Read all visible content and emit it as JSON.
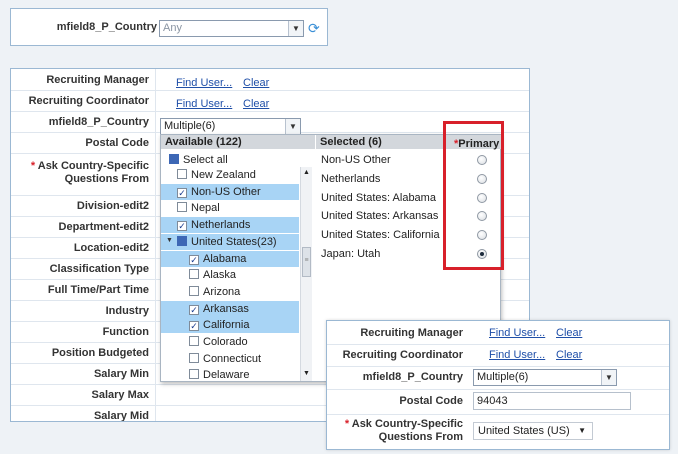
{
  "top_panel": {
    "field_label": "mfield8_P_Country",
    "select_value": "Any"
  },
  "main_form": {
    "rows": [
      {
        "label": "Recruiting Manager",
        "required": false
      },
      {
        "label": "Recruiting Coordinator",
        "required": false
      },
      {
        "label": "mfield8_P_Country",
        "required": false
      },
      {
        "label": "Postal Code",
        "required": false
      },
      {
        "label": "Ask Country-Specific",
        "label2": "Questions From",
        "required": true
      },
      {
        "label": "Division-edit2",
        "required": false
      },
      {
        "label": "Department-edit2",
        "required": false
      },
      {
        "label": "Location-edit2",
        "required": false
      },
      {
        "label": "Classification Type",
        "required": false
      },
      {
        "label": "Full Time/Part Time",
        "required": false
      },
      {
        "label": "Industry",
        "required": false
      },
      {
        "label": "Function",
        "required": false
      },
      {
        "label": "Position Budgeted",
        "required": false
      },
      {
        "label": "Salary Min",
        "required": false
      },
      {
        "label": "Salary Max",
        "required": false
      },
      {
        "label": "Salary Mid",
        "required": false
      }
    ],
    "find_user": "Find User...",
    "clear": "Clear",
    "country_select": "Multiple(6)"
  },
  "dropdown": {
    "available_header": "Available (122)",
    "selected_header": "Selected (6)",
    "primary_header": "Primary",
    "required_star": "*",
    "select_all": "Select all",
    "available_items": [
      {
        "label": "New Zealand",
        "checked": false,
        "selected": false,
        "indent": 0
      },
      {
        "label": "Non-US Other",
        "checked": true,
        "selected": true,
        "indent": 0
      },
      {
        "label": "Nepal",
        "checked": false,
        "selected": false,
        "indent": 0
      },
      {
        "label": "Netherlands",
        "checked": true,
        "selected": true,
        "indent": 0
      },
      {
        "label": "United States(23)",
        "checked": "partial",
        "selected": true,
        "indent": 0
      },
      {
        "label": "Alabama",
        "checked": true,
        "selected": true,
        "indent": 1
      },
      {
        "label": "Alaska",
        "checked": false,
        "selected": false,
        "indent": 1
      },
      {
        "label": "Arizona",
        "checked": false,
        "selected": false,
        "indent": 1
      },
      {
        "label": "Arkansas",
        "checked": true,
        "selected": true,
        "indent": 1
      },
      {
        "label": "California",
        "checked": true,
        "selected": true,
        "indent": 1
      },
      {
        "label": "Colorado",
        "checked": false,
        "selected": false,
        "indent": 1
      },
      {
        "label": "Connecticut",
        "checked": false,
        "selected": false,
        "indent": 1
      },
      {
        "label": "Delaware",
        "checked": false,
        "selected": false,
        "indent": 1
      }
    ],
    "selected_items": [
      {
        "label": "Non-US Other",
        "primary": false
      },
      {
        "label": "Netherlands",
        "primary": false
      },
      {
        "label": "United States: Alabama",
        "primary": false
      },
      {
        "label": "United States: Arkansas",
        "primary": false
      },
      {
        "label": "United States: California",
        "primary": false
      },
      {
        "label": "Japan: Utah",
        "primary": true
      }
    ]
  },
  "inset_form": {
    "recruiting_manager": "Recruiting Manager",
    "recruiting_coordinator": "Recruiting Coordinator",
    "country_label": "mfield8_P_Country",
    "postal_label": "Postal Code",
    "ask_label_1": "Ask Country-Specific",
    "ask_label_2": "Questions From",
    "required_star": "*",
    "find_user": "Find User...",
    "clear": "Clear",
    "country_select": "Multiple(6)",
    "postal_value": "94043",
    "questions_select": "United States (US)"
  },
  "colors": {
    "highlight_box": "#d8202a",
    "link": "#1f4fa8",
    "selected_row": "#a8d4f5"
  }
}
